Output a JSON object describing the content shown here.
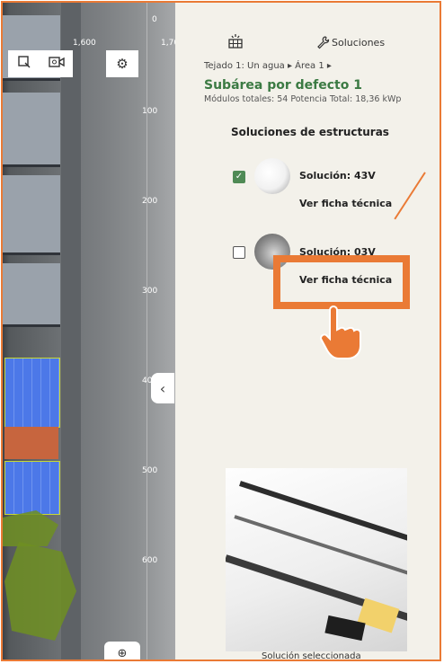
{
  "map": {
    "ruler_top": [
      "0",
      "1,600",
      "1,70"
    ],
    "ruler_side": [
      "100",
      "200",
      "300",
      "40",
      "500",
      "600"
    ],
    "toolbar_icons": [
      "select-area-icon",
      "camera-icon"
    ],
    "settings_icon": "gear-icon",
    "collapse_symbol": "‹",
    "zoom_symbol": "⊕"
  },
  "panel": {
    "solar_icon": "⛓",
    "solutions_tab": "Soluciones",
    "breadcrumb": "Tejado 1: Un agua ▸ Área 1 ▸",
    "subarea_title": "Subárea por defecto 1",
    "subarea_info": "Módulos totales: 54 Potencia Total: 18,36 kWp",
    "section_title": "Soluciones de estructuras",
    "solutions": [
      {
        "name": "Solución: 43V",
        "link": "Ver ficha técnica",
        "checked": true
      },
      {
        "name": "Solución: 03V",
        "link": "Ver ficha técnica",
        "checked": false
      }
    ],
    "preview_caption": "Solución seleccionada"
  },
  "colors": {
    "accent": "#ea7a35",
    "green": "#3b7a43",
    "panel_bg": "#f3f1ea"
  }
}
